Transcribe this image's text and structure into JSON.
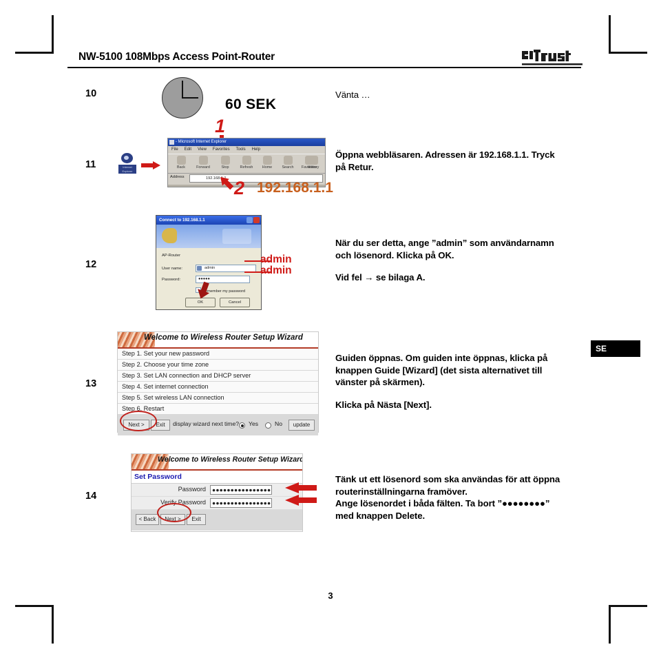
{
  "document": {
    "header_title": "NW-5100 108Mbps Access Point-Router",
    "brand": "Trust",
    "page_number": "3",
    "language_badge": "SE"
  },
  "steps": [
    {
      "number": "10",
      "clock_label": "60 SEK",
      "text_lines": [
        "Vänta …"
      ]
    },
    {
      "number": "11",
      "text_lines": [
        "Öppna webbläsaren. Adressen är 192.168.1.1. Tryck",
        "på Retur."
      ]
    },
    {
      "number": "12",
      "text_lines": [
        "När du ser detta, ange ”admin” som användarnamn",
        "och lösenord. Klicka på OK.",
        "Vid fel →  se bilaga A."
      ]
    },
    {
      "number": "13",
      "text_lines": [
        "Guiden öppnas. Om guiden inte öppnas, klicka på",
        "knappen Guide [Wizard] (det sista alternativet till",
        "vänster på skärmen).",
        "Klicka på Nästa [Next]."
      ]
    },
    {
      "number": "14",
      "text_lines": [
        "Tänk ut ett lösenord som ska användas för att öppna",
        "routerinställningarna framöver.",
        "Ange lösenordet i båda fälten. Ta bort ”●●●●●●●●”",
        "med knappen Delete."
      ]
    }
  ],
  "browser_shot": {
    "window_title": "- Microsoft Internet Explorer",
    "menu": [
      "File",
      "Edit",
      "View",
      "Favorites",
      "Tools",
      "Help"
    ],
    "toolbar_buttons": [
      "Back",
      "Forward",
      "Stop",
      "Refresh",
      "Home",
      "Search",
      "Favorites",
      "History"
    ],
    "address_label": "Address",
    "address_value": "192.168.1.1",
    "desktop_icon_label": "Internet Explorer",
    "annotation_1": "1",
    "annotation_2": "2",
    "annotation_ip": "192.168.1.1"
  },
  "login_dialog": {
    "title": "Connect to 192.168.1.1",
    "realm": "AP-Router",
    "username_label": "User name:",
    "username_value": "admin",
    "password_label": "Password:",
    "password_value": "●●●●●",
    "remember_label": "Remember my password",
    "ok_label": "OK",
    "cancel_label": "Cancel",
    "callout_username": "admin",
    "callout_password": "admin"
  },
  "wizard_welcome": {
    "banner_title": "Welcome to Wireless Router Setup Wizard",
    "steps": [
      "Step 1. Set your new password",
      "Step 2. Choose your time zone",
      "Step 3. Set LAN connection and DHCP server",
      "Step 4. Set internet connection",
      "Step 5. Set wireless LAN connection",
      "Step 6. Restart"
    ],
    "next_label": "Next >",
    "exit_label": "Exit",
    "question": "display wizard next time?",
    "yes_label": "Yes",
    "no_label": "No",
    "update_label": "update"
  },
  "wizard_password": {
    "banner_title": "Welcome to Wireless Router Setup Wizard",
    "section_title": "Set Password",
    "password_label": "Password",
    "password_value": "●●●●●●●●●●●●●●●●",
    "verify_label": "Verify Password",
    "verify_value": "●●●●●●●●●●●●●●●●",
    "back_label": "< Back",
    "next_label": "Next >",
    "exit_label": "Exit"
  },
  "colors": {
    "accent_red": "#cf1a17",
    "brand_black": "#111111",
    "wizard_rule": "#b33b26",
    "link_blue": "#1a1ab0"
  }
}
